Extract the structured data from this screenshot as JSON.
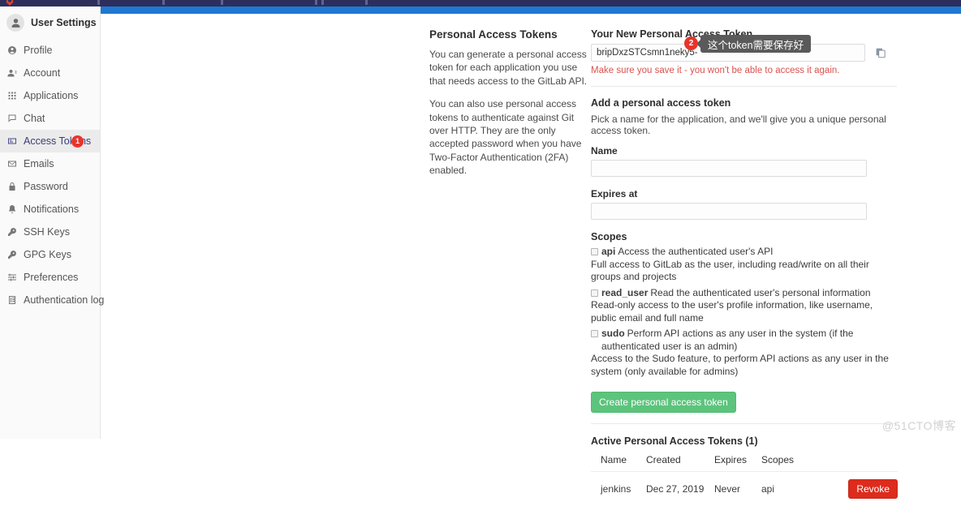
{
  "topbar": {
    "logo": "gitlab-logo-icon"
  },
  "flash": {
    "message": ""
  },
  "sidebar": {
    "title": "User Settings",
    "avatar_icon": "user-avatar-icon",
    "items": [
      {
        "label": "Profile",
        "icon": "profile-circle-icon",
        "active": false,
        "badge": ""
      },
      {
        "label": "Account",
        "icon": "account-person-icon",
        "active": false,
        "badge": ""
      },
      {
        "label": "Applications",
        "icon": "applications-grid-icon",
        "active": false,
        "badge": ""
      },
      {
        "label": "Chat",
        "icon": "chat-bubble-icon",
        "active": false,
        "badge": ""
      },
      {
        "label": "Access Tokens",
        "icon": "token-card-icon",
        "active": true,
        "badge": "1"
      },
      {
        "label": "Emails",
        "icon": "envelope-icon",
        "active": false,
        "badge": ""
      },
      {
        "label": "Password",
        "icon": "lock-icon",
        "active": false,
        "badge": ""
      },
      {
        "label": "Notifications",
        "icon": "bell-icon",
        "active": false,
        "badge": ""
      },
      {
        "label": "SSH Keys",
        "icon": "key-icon",
        "active": false,
        "badge": ""
      },
      {
        "label": "GPG Keys",
        "icon": "key-icon",
        "active": false,
        "badge": ""
      },
      {
        "label": "Preferences",
        "icon": "sliders-icon",
        "active": false,
        "badge": ""
      },
      {
        "label": "Authentication log",
        "icon": "log-book-icon",
        "active": false,
        "badge": ""
      }
    ]
  },
  "description": {
    "title": "Personal Access Tokens",
    "paragraph1": "You can generate a personal access token for each application you use that needs access to the GitLab API.",
    "paragraph2": "You can also use personal access tokens to authenticate against Git over HTTP. They are the only accepted password when you have Two-Factor Authentication (2FA) enabled."
  },
  "new_token": {
    "label": "Your New Personal Access Token",
    "value": "bripDxzSTCsmn1neky5-",
    "placeholder": "",
    "copy_icon": "copy-clipboard-icon",
    "warning": "Make sure you save it - you won't be able to access it again."
  },
  "annotation": {
    "marker": "2",
    "text": "这个token需要保存好"
  },
  "add_token": {
    "heading": "Add a personal access token",
    "helper": "Pick a name for the application, and we'll give you a unique personal access token.",
    "name_label": "Name",
    "name_value": "",
    "name_placeholder": "",
    "expires_label": "Expires at",
    "expires_value": "",
    "expires_placeholder": "",
    "submit_label": "Create personal access token"
  },
  "scopes": {
    "heading": "Scopes",
    "items": [
      {
        "name": "api",
        "summary": "Access the authenticated user's API",
        "description": "Full access to GitLab as the user, including read/write on all their groups and projects",
        "checked": false
      },
      {
        "name": "read_user",
        "summary": "Read the authenticated user's personal information",
        "description": "Read-only access to the user's profile information, like username, public email and full name",
        "checked": false
      },
      {
        "name": "sudo",
        "summary": "Perform API actions as any user in the system (if the authenticated user is an admin)",
        "description": "Access to the Sudo feature, to perform API actions as any user in the system (only available for admins)",
        "checked": false
      }
    ]
  },
  "active_tokens": {
    "title": "Active Personal Access Tokens (1)",
    "columns": [
      "Name",
      "Created",
      "Expires",
      "Scopes"
    ],
    "rows": [
      {
        "name": "jenkins",
        "created": "Dec 27, 2019",
        "expires": "Never",
        "scopes": "api",
        "action_label": "Revoke"
      }
    ]
  },
  "watermark": "@51CTO博客",
  "colors": {
    "navbar": "#2e2e5c",
    "flash": "#1f78d1",
    "sidebar_bg": "#fafafa",
    "active_item": "#ebebeb",
    "badge_red": "#e8342a",
    "create_green": "#5cc47c",
    "revoke_red": "#dd2b1c",
    "warning_red": "#d9534f",
    "tooltip_gray": "#5a5a5a"
  }
}
